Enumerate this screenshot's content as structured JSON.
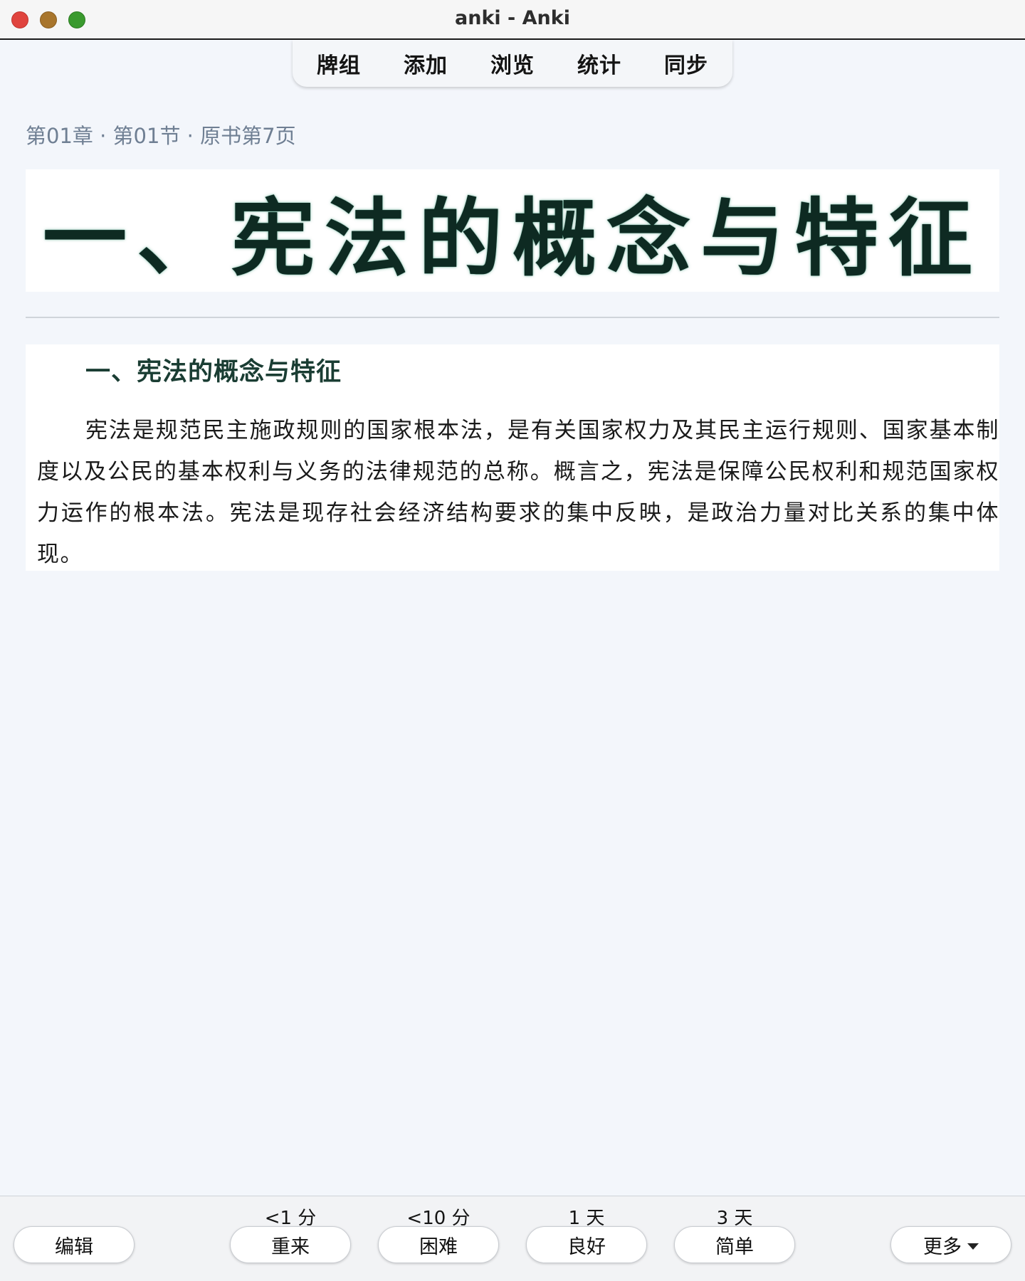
{
  "window": {
    "title": "anki - Anki"
  },
  "topnav": {
    "items": [
      {
        "label": "牌组"
      },
      {
        "label": "添加"
      },
      {
        "label": "浏览"
      },
      {
        "label": "统计"
      },
      {
        "label": "同步"
      }
    ]
  },
  "card": {
    "breadcrumb": "第01章 · 第01节 · 原书第7页",
    "banner_title": "一、宪法的概念与特征",
    "scan_heading": "一、宪法的概念与特征",
    "scan_paragraph": "宪法是规范民主施政规则的国家根本法，是有关国家权力及其民主运行规则、国家基本制度以及公民的基本权利与义务的法律规范的总称。概言之，宪法是保障公民权利和规范国家权力运作的根本法。宪法是现存社会经济结构要求的集中反映，是政治力量对比关系的集中体现。"
  },
  "bottombar": {
    "edit_label": "编辑",
    "answers": [
      {
        "interval": "<1 分",
        "label": "重来"
      },
      {
        "interval": "<10 分",
        "label": "困难"
      },
      {
        "interval": "1 天",
        "label": "良好"
      },
      {
        "interval": "3 天",
        "label": "简单"
      }
    ],
    "more_label": "更多"
  },
  "colors": {
    "background": "#f3f6fb",
    "breadcrumb": "#6f7f93",
    "banner_text": "#0e2a22",
    "close": "#e0443e",
    "minimize": "#a8752c",
    "maximize": "#3a9a2e"
  }
}
